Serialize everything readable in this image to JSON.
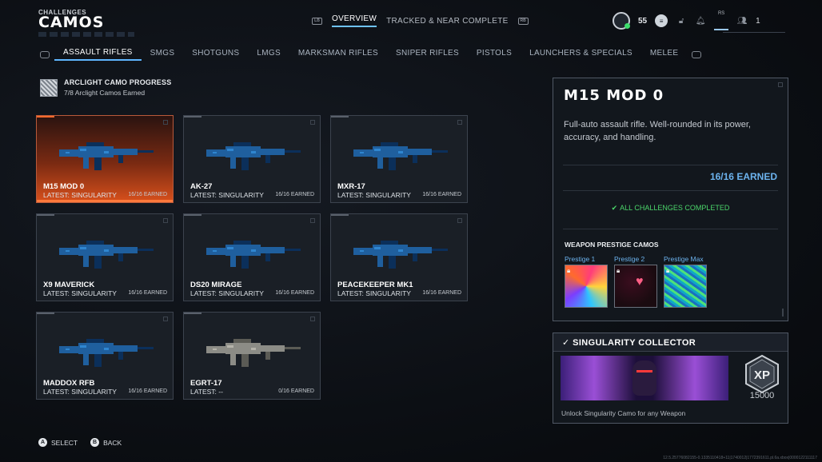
{
  "header": {
    "section": "CHALLENGES",
    "title": "CAMOS"
  },
  "top_nav": {
    "left_glyph": "LB",
    "right_glyph": "RB",
    "tabs": [
      {
        "label": "OVERVIEW",
        "active": true
      },
      {
        "label": "TRACKED & NEAR COMPLETE",
        "active": false
      }
    ]
  },
  "status_bar": {
    "level": "55",
    "rs_label": "RS",
    "count": "1"
  },
  "categories": {
    "tabs": [
      {
        "label": "ASSAULT RIFLES",
        "active": true
      },
      {
        "label": "SMGS",
        "active": false
      },
      {
        "label": "SHOTGUNS",
        "active": false
      },
      {
        "label": "LMGS",
        "active": false
      },
      {
        "label": "MARKSMAN RIFLES",
        "active": false
      },
      {
        "label": "SNIPER RIFLES",
        "active": false
      },
      {
        "label": "PISTOLS",
        "active": false
      },
      {
        "label": "LAUNCHERS & SPECIALS",
        "active": false
      },
      {
        "label": "MELEE",
        "active": false
      }
    ]
  },
  "progress": {
    "title": "ARCLIGHT CAMO PROGRESS",
    "subtitle": "7/8 Arclight Camos Earned"
  },
  "weapons": [
    {
      "name": "M15 MOD 0",
      "latest": "LATEST: SINGULARITY",
      "earned": "16/16 EARNED",
      "selected": true,
      "camo": "blue"
    },
    {
      "name": "AK-27",
      "latest": "LATEST: SINGULARITY",
      "earned": "16/16 EARNED",
      "selected": false,
      "camo": "blue"
    },
    {
      "name": "MXR-17",
      "latest": "LATEST: SINGULARITY",
      "earned": "16/16 EARNED",
      "selected": false,
      "camo": "blue"
    },
    {
      "name": "X9 MAVERICK",
      "latest": "LATEST: SINGULARITY",
      "earned": "16/16 EARNED",
      "selected": false,
      "camo": "blue"
    },
    {
      "name": "DS20 MIRAGE",
      "latest": "LATEST: SINGULARITY",
      "earned": "16/16 EARNED",
      "selected": false,
      "camo": "blue"
    },
    {
      "name": "PEACEKEEPER MK1",
      "latest": "LATEST: SINGULARITY",
      "earned": "16/16 EARNED",
      "selected": false,
      "camo": "blue"
    },
    {
      "name": "MADDOX RFB",
      "latest": "LATEST: SINGULARITY",
      "earned": "16/16 EARNED",
      "selected": false,
      "camo": "blue"
    },
    {
      "name": "EGRT-17",
      "latest": "LATEST: --",
      "earned": "0/16 EARNED",
      "selected": false,
      "camo": "base"
    }
  ],
  "detail": {
    "title": "M15 MOD 0",
    "description": "Full-auto assault rifle. Well-rounded in its power, accuracy, and handling.",
    "earned": "16/16 EARNED",
    "all_completed": "ALL CHALLENGES COMPLETED",
    "prestige_heading": "WEAPON PRESTIGE CAMOS",
    "prestige": [
      {
        "label": "Prestige 1"
      },
      {
        "label": "Prestige 2"
      },
      {
        "label": "Prestige Max"
      }
    ]
  },
  "collector": {
    "title": "SINGULARITY COLLECTOR",
    "xp_icon_text": "XP",
    "xp_value": "15000",
    "description": "Unlock Singularity Camo for any Weapon"
  },
  "footer": {
    "select_glyph": "A",
    "select_label": "SELECT",
    "back_glyph": "B",
    "back_label": "BACK",
    "build": "12.5.25776082155-0.1335110418+11|1740012|1772391611.pl.6a.xbox|0000122111117"
  },
  "colors": {
    "accent_blue": "#6cb3ee",
    "selected_orange": "#d8501c",
    "complete_green": "#4bd66a"
  }
}
